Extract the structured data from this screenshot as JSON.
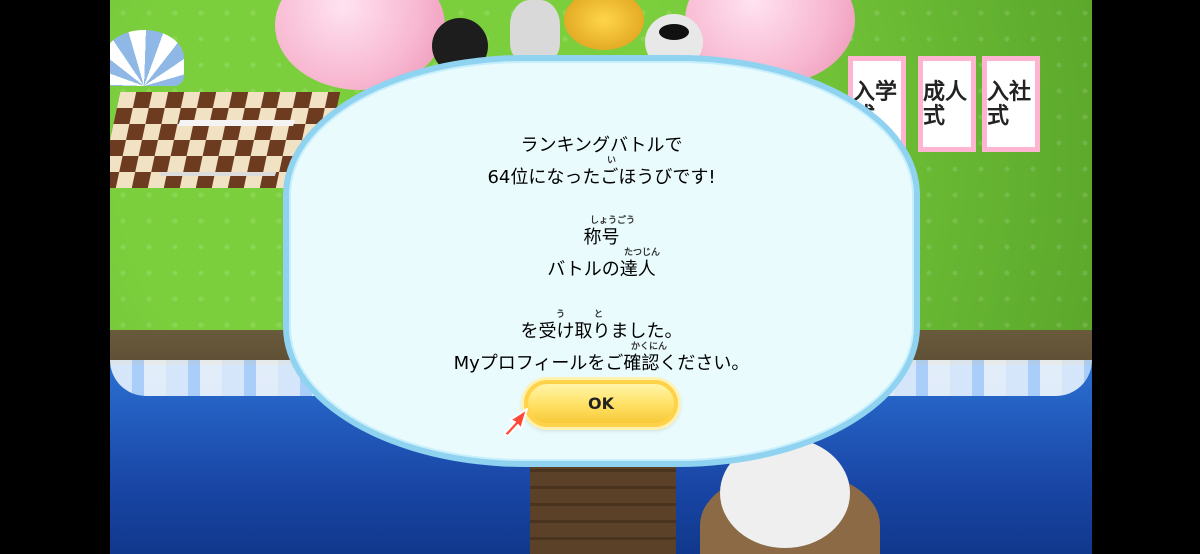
{
  "dialog": {
    "line1": "ランキングバトルで",
    "line2": "64位になったごほうびです!",
    "line2_ruby": "い",
    "line3": "称号",
    "line3_ruby": "しょうごう",
    "line4": "バトルの達人",
    "line4_ruby": "たつじん",
    "line5": "を受け取りました。",
    "line5_ruby_1": "う",
    "line5_ruby_2": "と",
    "line6": "Myプロフィールをご確認ください。",
    "line6_ruby": "かくにん"
  },
  "ok_button": {
    "label": "OK"
  },
  "signs": [
    "入学式",
    "成人式",
    "入社式"
  ],
  "colors": {
    "dialog_bg": "#e9fbfd",
    "dialog_border": "#8fd3f1",
    "button_fill": "#ffe063",
    "pointer": "#ff4a3a"
  },
  "icons": {
    "pointer": "hand-pointer-icon"
  }
}
